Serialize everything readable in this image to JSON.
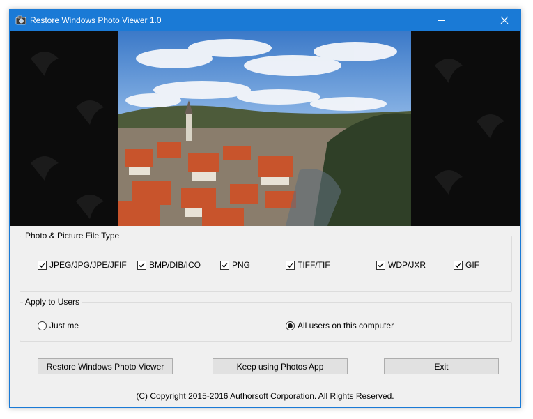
{
  "window": {
    "title": "Restore Windows Photo Viewer 1.0",
    "accent_color": "#1a7ad6",
    "controls": [
      "minimize-icon",
      "maximize-icon",
      "close-icon"
    ]
  },
  "file_types": {
    "legend": "Photo & Picture File Type",
    "items": [
      {
        "label": "JPEG/JPG/JPE/JFIF",
        "checked": true
      },
      {
        "label": "BMP/DIB/ICO",
        "checked": true
      },
      {
        "label": "PNG",
        "checked": true
      },
      {
        "label": "TIFF/TIF",
        "checked": true
      },
      {
        "label": "WDP/JXR",
        "checked": true
      },
      {
        "label": "GIF",
        "checked": true
      }
    ]
  },
  "users": {
    "legend": "Apply to Users",
    "options": [
      {
        "label": "Just me",
        "selected": false
      },
      {
        "label": "All users on this computer",
        "selected": true
      }
    ]
  },
  "buttons": {
    "restore": "Restore Windows Photo Viewer",
    "keep": "Keep using Photos App",
    "exit": "Exit"
  },
  "footer": {
    "copyright": "(C) Copyright 2015-2016 Authorsoft Corporation. All Rights Reserved."
  }
}
